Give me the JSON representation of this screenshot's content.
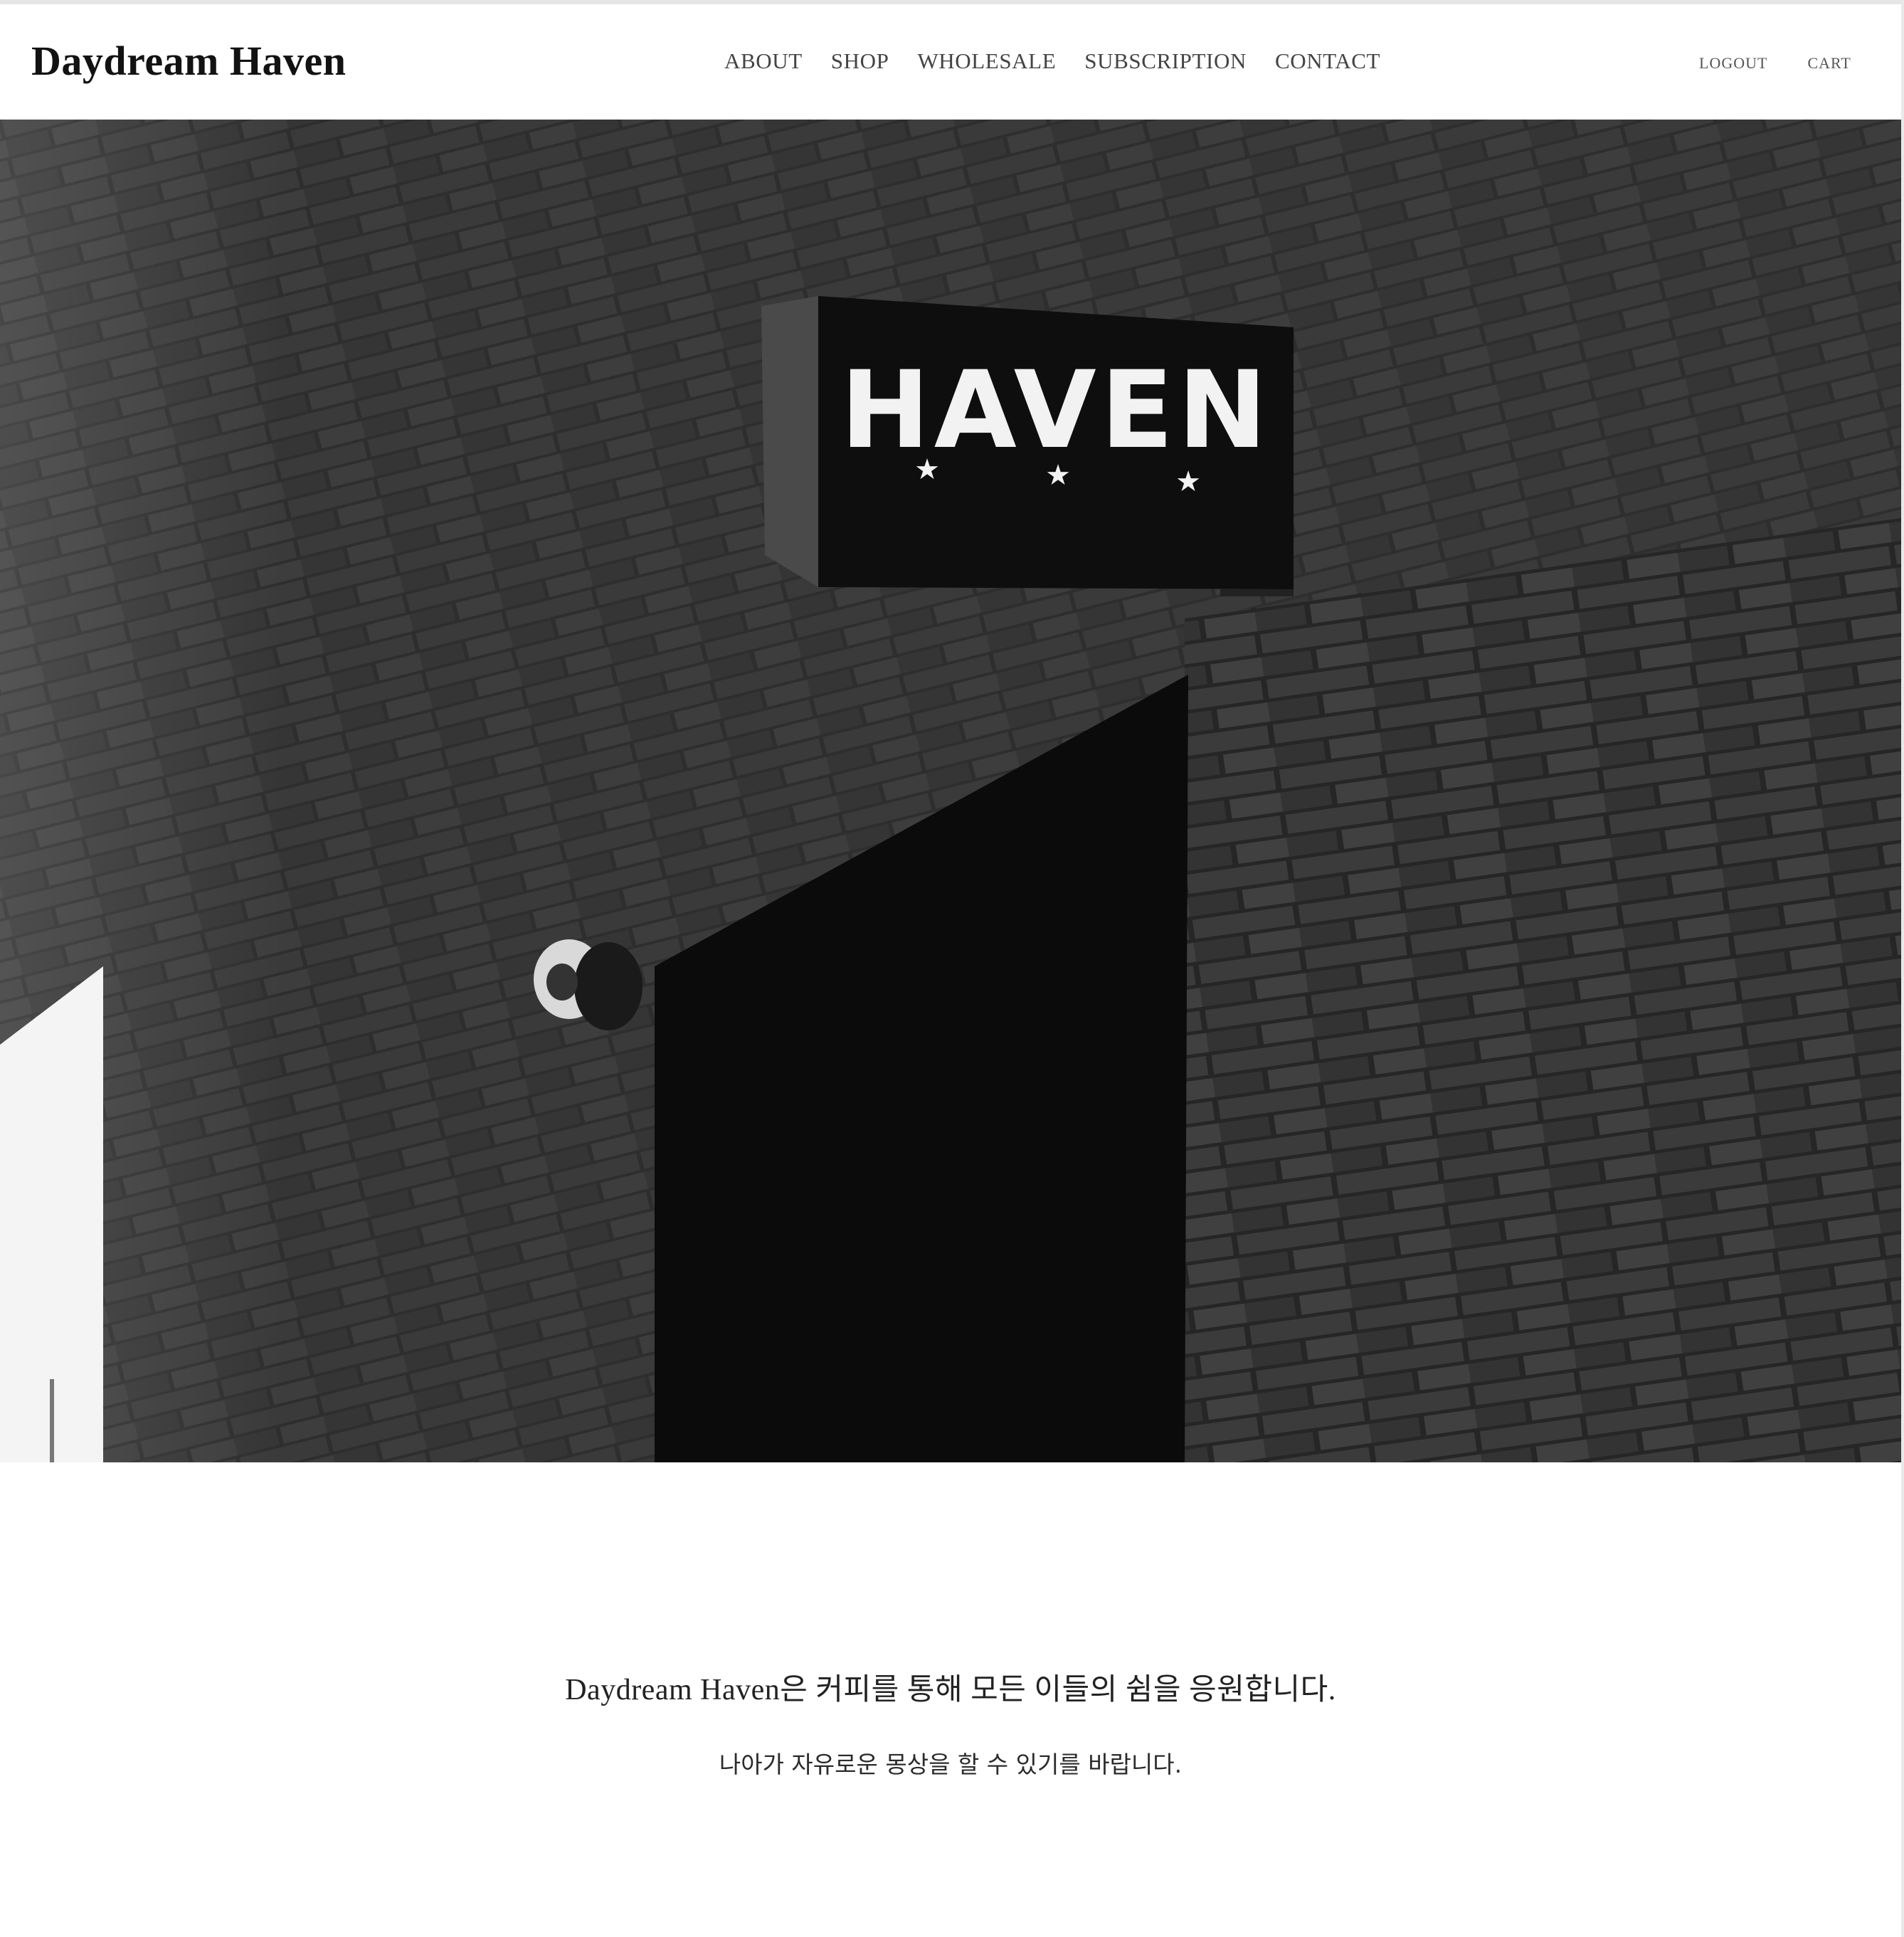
{
  "header": {
    "brand": "Daydream Haven",
    "nav": [
      {
        "label": "ABOUT",
        "name": "nav-about"
      },
      {
        "label": "SHOP",
        "name": "nav-shop"
      },
      {
        "label": "WHOLESALE",
        "name": "nav-wholesale"
      },
      {
        "label": "SUBSCRIPTION",
        "name": "nav-subscription"
      },
      {
        "label": "CONTACT",
        "name": "nav-contact"
      }
    ],
    "logout_label": "LOGOUT",
    "cart_label": "CART"
  },
  "hero": {
    "sign_text": "HAVEN",
    "image_description_icon": "storefront-sign-photo"
  },
  "main": {
    "headline": "Daydream Haven은 커피를 통해 모든 이들의 쉼을 응원합니다.",
    "subline": "나아가 자유로운 몽상을 할 수 있기를 바랍니다."
  }
}
